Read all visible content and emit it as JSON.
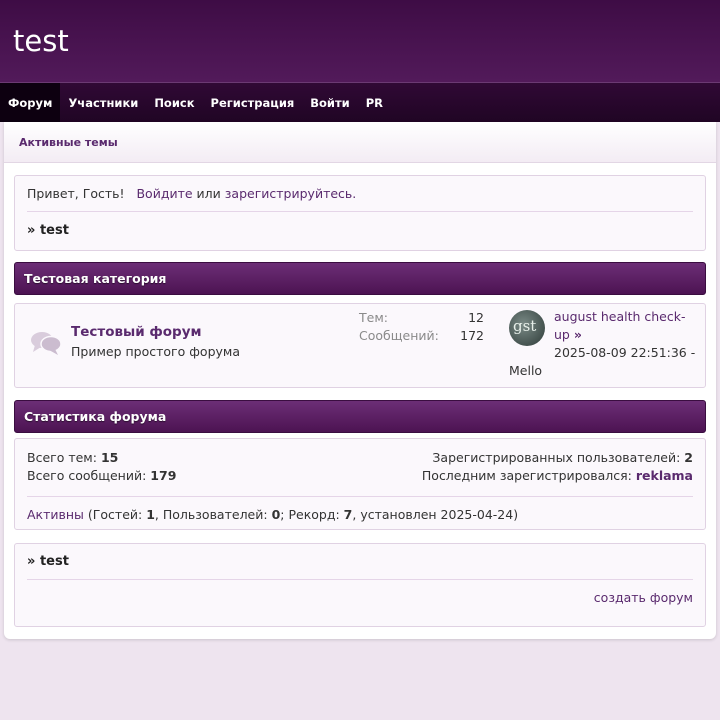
{
  "site": {
    "title": "test"
  },
  "nav": {
    "items": [
      {
        "label": "Форум",
        "active": true
      },
      {
        "label": "Участники"
      },
      {
        "label": "Поиск"
      },
      {
        "label": "Регистрация"
      },
      {
        "label": "Войти"
      },
      {
        "label": "PR"
      }
    ]
  },
  "subbar": {
    "active_topics": "Активные темы"
  },
  "welcome": {
    "greeting": "Привет, Гость!",
    "login_link": "Войдите",
    "or": "или",
    "register_link": "зарегистрируйтесь",
    "period": ".",
    "crumb_prefix": "»",
    "crumb": "test"
  },
  "category": {
    "title": "Тестовая категория",
    "forum": {
      "name": "Тестовый форум",
      "description": "Пример простого форума",
      "topics_label": "Тем:",
      "topics_value": "12",
      "posts_label": "Сообщений:",
      "posts_value": "172",
      "last_post": {
        "title_line1": "august health check-",
        "title_line2": "up",
        "arrow": "»",
        "date": "2025-08-09 22:51:36 -",
        "author": "Mello",
        "avatar_text": "gst"
      }
    }
  },
  "stats": {
    "title": "Статистика форума",
    "total_topics_label": "Всего тем:",
    "total_topics_value": "15",
    "total_posts_label": "Всего сообщений:",
    "total_posts_value": "179",
    "registered_label": "Зарегистрированных пользователей:",
    "registered_value": "2",
    "last_registered_label": "Последним зарегистрировался:",
    "last_registered_value": "reklama",
    "active_link": "Активны",
    "guests_label": "(Гостей:",
    "guests_value": "1",
    "users_label": ", Пользователей:",
    "users_value": "0",
    "record_label": "; Рекорд:",
    "record_value": "7",
    "record_date": ", установлен 2025-04-24)"
  },
  "footer_box": {
    "crumb_prefix": "»",
    "crumb": "test",
    "create_forum": "создать форум"
  },
  "colors": {
    "header": "#4a1452",
    "nav": "#260628",
    "accent": "#5a2a6e",
    "background": "#eee4ef"
  }
}
